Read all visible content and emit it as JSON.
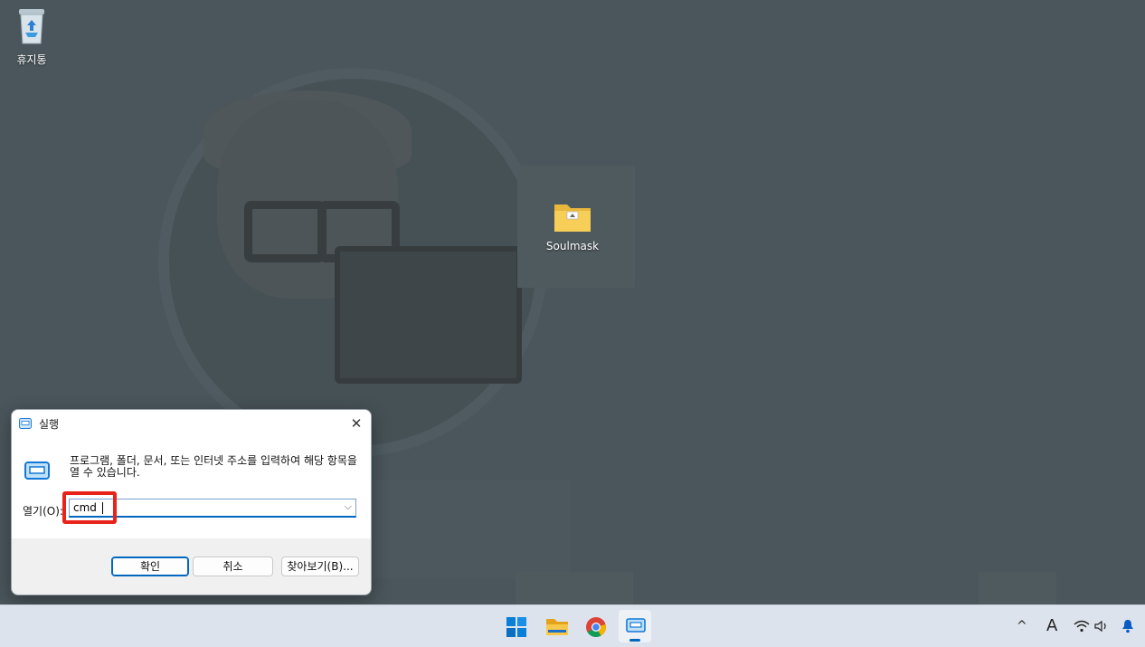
{
  "desktop": {
    "icons": [
      {
        "label": "휴지통",
        "icon": "recycle-bin-icon"
      },
      {
        "label": "Soulmask",
        "icon": "folder-icon"
      }
    ]
  },
  "run_dialog": {
    "title": "실행",
    "description": "프로그램, 폴더, 문서, 또는 인터넷 주소를 입력하여 해당 항목을 열 수 있습니다.",
    "open_label": "열기(O):",
    "input_value": "cmd",
    "buttons": {
      "ok": "확인",
      "cancel": "취소",
      "browse": "찾아보기(B)..."
    },
    "highlight_color": "#e8231a"
  },
  "taskbar": {
    "apps": [
      {
        "name": "start",
        "icon": "windows-start-icon"
      },
      {
        "name": "file-explorer",
        "icon": "file-explorer-icon"
      },
      {
        "name": "chrome",
        "icon": "chrome-icon"
      },
      {
        "name": "run",
        "icon": "run-dialog-icon",
        "active": true
      }
    ],
    "tray": {
      "overflow": "^",
      "ime": "A",
      "icons": [
        "wifi-icon",
        "volume-icon",
        "notification-bell-icon"
      ]
    }
  },
  "colors": {
    "accent": "#0067c0",
    "desktop_bg": "#4a565c"
  }
}
